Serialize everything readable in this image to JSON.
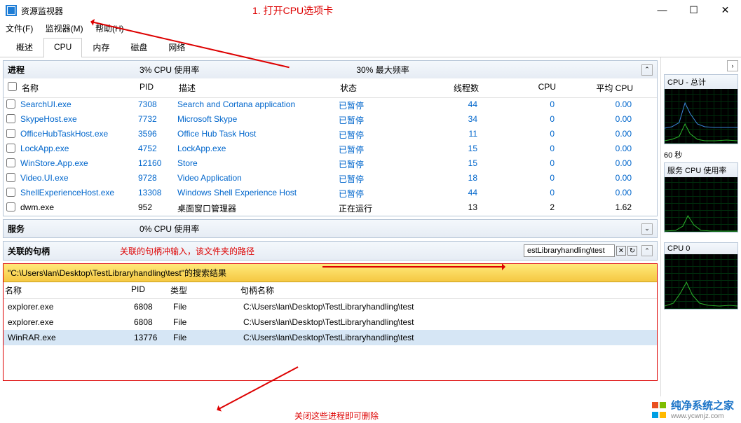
{
  "window": {
    "title": "资源监视器"
  },
  "annotations": {
    "a1": "1. 打开CPU选项卡",
    "a2": "关联的句柄冲输入，该文件夹的路径",
    "a3": "关闭这些进程即可删除"
  },
  "menubar": [
    "文件(F)",
    "监视器(M)",
    "帮助(H)"
  ],
  "tabs": [
    "概述",
    "CPU",
    "内存",
    "磁盘",
    "网络"
  ],
  "active_tab": "CPU",
  "proc_panel": {
    "title": "进程",
    "stat1": "3% CPU 使用率",
    "stat2": "30% 最大频率",
    "cols": {
      "name": "名称",
      "pid": "PID",
      "desc": "描述",
      "stat": "状态",
      "thr": "线程数",
      "cpu": "CPU",
      "avg": "平均 CPU"
    }
  },
  "processes": [
    {
      "name": "SearchUI.exe",
      "pid": "7308",
      "desc": "Search and Cortana application",
      "stat": "已暂停",
      "thr": "44",
      "cpu": "0",
      "avg": "0.00",
      "running": false
    },
    {
      "name": "SkypeHost.exe",
      "pid": "7732",
      "desc": "Microsoft Skype",
      "stat": "已暂停",
      "thr": "34",
      "cpu": "0",
      "avg": "0.00",
      "running": false
    },
    {
      "name": "OfficeHubTaskHost.exe",
      "pid": "3596",
      "desc": "Office Hub Task Host",
      "stat": "已暂停",
      "thr": "11",
      "cpu": "0",
      "avg": "0.00",
      "running": false
    },
    {
      "name": "LockApp.exe",
      "pid": "4752",
      "desc": "LockApp.exe",
      "stat": "已暂停",
      "thr": "15",
      "cpu": "0",
      "avg": "0.00",
      "running": false
    },
    {
      "name": "WinStore.App.exe",
      "pid": "12160",
      "desc": "Store",
      "stat": "已暂停",
      "thr": "15",
      "cpu": "0",
      "avg": "0.00",
      "running": false
    },
    {
      "name": "Video.UI.exe",
      "pid": "9728",
      "desc": "Video Application",
      "stat": "已暂停",
      "thr": "18",
      "cpu": "0",
      "avg": "0.00",
      "running": false
    },
    {
      "name": "ShellExperienceHost.exe",
      "pid": "13308",
      "desc": "Windows Shell Experience Host",
      "stat": "已暂停",
      "thr": "44",
      "cpu": "0",
      "avg": "0.00",
      "running": false
    },
    {
      "name": "dwm.exe",
      "pid": "952",
      "desc": "桌面窗口管理器",
      "stat": "正在运行",
      "thr": "13",
      "cpu": "2",
      "avg": "1.62",
      "running": true
    }
  ],
  "svc_panel": {
    "title": "服务",
    "stat1": "0% CPU 使用率"
  },
  "handles": {
    "title": "关联的句柄",
    "search_value": "estLibraryhandling\\test",
    "banner": "\"C:\\Users\\lan\\Desktop\\TestLibraryhandling\\test\"的搜索结果",
    "cols": {
      "name": "名称",
      "pid": "PID",
      "type": "类型",
      "hname": "句柄名称"
    },
    "rows": [
      {
        "name": "explorer.exe",
        "pid": "6808",
        "type": "File",
        "hname": "C:\\Users\\lan\\Desktop\\TestLibraryhandling\\test",
        "sel": false
      },
      {
        "name": "explorer.exe",
        "pid": "6808",
        "type": "File",
        "hname": "C:\\Users\\lan\\Desktop\\TestLibraryhandling\\test",
        "sel": false
      },
      {
        "name": "WinRAR.exe",
        "pid": "13776",
        "type": "File",
        "hname": "C:\\Users\\lan\\Desktop\\TestLibraryhandling\\test",
        "sel": true
      }
    ]
  },
  "charts": {
    "c1_title": "CPU - 总计",
    "c1_sub": "60 秒",
    "c2_title": "服务 CPU 使用率",
    "c3_title": "CPU 0"
  },
  "watermark": {
    "brand": "纯净系统之家",
    "url": "www.ycwnjz.com"
  },
  "chart_data": [
    {
      "type": "line",
      "title": "CPU - 总计",
      "xlabel": "",
      "ylabel": "%",
      "ylim": [
        0,
        100
      ],
      "x_seconds": 60,
      "series": [
        {
          "name": "CPU 使用率",
          "color": "#2bb12b",
          "values": [
            3,
            4,
            3,
            5,
            6,
            5,
            4,
            8,
            25,
            15,
            7,
            5,
            4,
            3,
            3,
            4,
            3,
            3,
            4,
            3
          ]
        },
        {
          "name": "最大频率",
          "color": "#3a85d6",
          "values": [
            28,
            30,
            29,
            32,
            35,
            60,
            80,
            55,
            40,
            35,
            32,
            30,
            30,
            31,
            29,
            30,
            30,
            30,
            30,
            30
          ]
        }
      ]
    },
    {
      "type": "line",
      "title": "服务 CPU 使用率",
      "xlabel": "",
      "ylabel": "%",
      "ylim": [
        0,
        100
      ],
      "x_seconds": 60,
      "series": [
        {
          "name": "服务 CPU",
          "color": "#2bb12b",
          "values": [
            0,
            1,
            0,
            2,
            3,
            5,
            12,
            8,
            4,
            2,
            1,
            0,
            1,
            0,
            0,
            1,
            0,
            0,
            1,
            0
          ]
        }
      ]
    },
    {
      "type": "line",
      "title": "CPU 0",
      "xlabel": "",
      "ylabel": "%",
      "ylim": [
        0,
        100
      ],
      "x_seconds": 60,
      "series": [
        {
          "name": "CPU 0",
          "color": "#2bb12b",
          "values": [
            2,
            3,
            4,
            6,
            8,
            20,
            35,
            22,
            10,
            6,
            4,
            3,
            3,
            4,
            3,
            3,
            4,
            3,
            3,
            3
          ]
        }
      ]
    }
  ]
}
